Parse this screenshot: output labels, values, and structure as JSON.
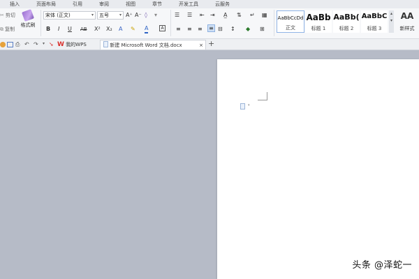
{
  "menubar": {
    "items": [
      "插入",
      "页面布局",
      "引用",
      "审阅",
      "视图",
      "章节",
      "开发工具",
      "云服务"
    ]
  },
  "ribbon": {
    "clipboard": {
      "cut_label": "剪切",
      "copy_label": "复制",
      "format_painter_label": "格式刷"
    },
    "font": {
      "family_value": "宋体 (正文)",
      "size_value": "五号"
    },
    "format_buttons": {
      "bold": "B",
      "italic": "I",
      "underline": "U",
      "strike": "AB",
      "superscript": "X²",
      "subscript": "X₂",
      "font_color": "A",
      "grow": "A⁺",
      "shrink": "A⁻"
    },
    "styles": [
      {
        "sample": "AaBbCcDd",
        "caption": "正文"
      },
      {
        "sample": "AaBb",
        "caption": "标题 1"
      },
      {
        "sample": "AaBb(",
        "caption": "标题 2"
      },
      {
        "sample": "AaBbC",
        "caption": "标题 3"
      }
    ],
    "new_style_label": "新样式",
    "new_style_icon": "AA"
  },
  "tabbar": {
    "wps_tab_label": "我的WPS",
    "doc_tab_label": "新建 Microsoft Word 文档.docx",
    "close_symbol": "×",
    "add_symbol": "+"
  },
  "document": {
    "placeholder_icon": "document-icon"
  },
  "watermark": {
    "text": "头条 @泽蛇一"
  },
  "colors": {
    "background": "#b6bbc7",
    "page": "#ffffff",
    "menubar": "#e9ebef",
    "ribbon": "#f6f7f9",
    "accent_red": "#d9302c",
    "accent_blue": "#2e63c5"
  }
}
